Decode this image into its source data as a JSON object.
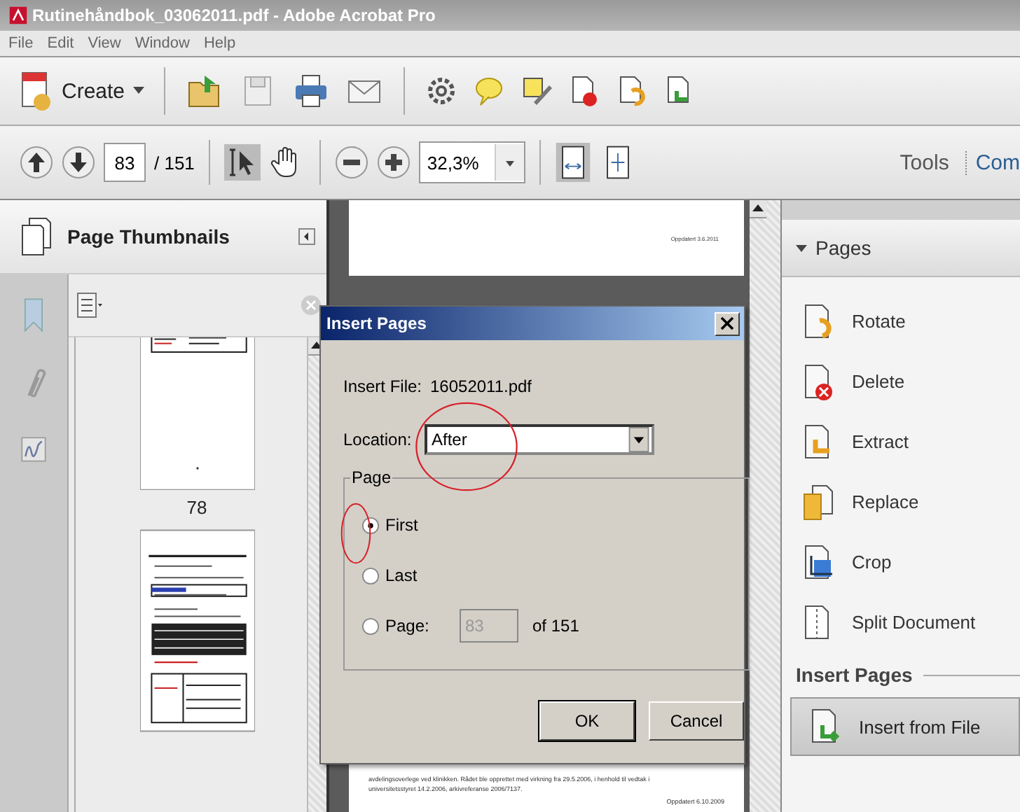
{
  "window": {
    "title": "Rutinehåndbok_03062011.pdf - Adobe Acrobat Pro"
  },
  "menu": [
    "File",
    "Edit",
    "View",
    "Window",
    "Help"
  ],
  "toolbar": {
    "create": "Create"
  },
  "navigation": {
    "page": "83",
    "page_count": "/ 151",
    "zoom": "32,3%",
    "tools": "Tools",
    "comment": "Com"
  },
  "left_panel": {
    "title": "Page Thumbnails",
    "thumbnail_labels": [
      "78"
    ]
  },
  "document": {
    "top_date": "Oppdatert 3.6.2011",
    "body_text": "avdelingsoverlege ved klinikken. Rådet ble opprettet med virkning fra 29.5.2006, i henhold til vedtak i universitetsstyret 14.2.2006, arkivreferanse 2006/7137.",
    "bottom_date": "Oppdatert 6.10.2009"
  },
  "right_panel": {
    "section": "Pages",
    "expanded": true,
    "items": [
      {
        "label": "Rotate",
        "kind": "rotate"
      },
      {
        "label": "Delete",
        "kind": "delete"
      },
      {
        "label": "Extract",
        "kind": "extract"
      },
      {
        "label": "Replace",
        "kind": "replace"
      },
      {
        "label": "Crop",
        "kind": "crop"
      },
      {
        "label": "Split Document",
        "kind": "split"
      }
    ],
    "insert_title": "Insert Pages",
    "insert_items": [
      {
        "label": "Insert from File",
        "selected": true
      }
    ]
  },
  "dialog": {
    "title": "Insert Pages",
    "file_label": "Insert File:",
    "file_name": "16052011.pdf",
    "location_label": "Location:",
    "location": "After",
    "group_label": "Page",
    "options": [
      {
        "label": "First",
        "selected": true
      },
      {
        "label": "Last",
        "selected": false
      },
      {
        "label": "Page:",
        "selected": false
      }
    ],
    "page_value": "83",
    "page_disabled": true,
    "of_label": "of 151",
    "buttons": [
      "OK",
      "Cancel"
    ]
  }
}
